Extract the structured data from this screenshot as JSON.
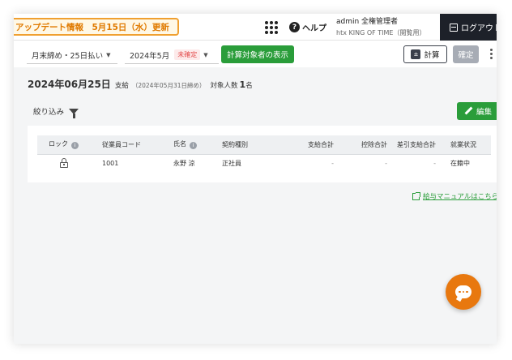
{
  "topbar": {
    "notice": "アップデート情報　5月15日（水）更新",
    "help_label": "ヘルプ",
    "user_name": "admin 全権管理者",
    "tenant_name": "htx KING OF TIME（閲覧用）",
    "logout_label": "ログアウト"
  },
  "toolbar": {
    "closing_select": "月末締め・25日払い",
    "month_select": "2024年5月",
    "unconfirmed_badge": "未確定",
    "target_button": "計算対象者の表示",
    "calc_button": "計算",
    "confirm_button": "確定"
  },
  "summary": {
    "pay_date": "2024年06月25日",
    "pay_type": "支給",
    "closing_note": "（2024年05月31日締め）",
    "count_label": "対象人数",
    "count_value": "1",
    "count_unit": "名"
  },
  "filter": {
    "label": "絞り込み"
  },
  "edit_button": "編集",
  "table": {
    "columns": [
      "ロック",
      "従業員コード",
      "氏名",
      "契約種別",
      "支給合計",
      "控除合計",
      "差引支給合計",
      "就業状況"
    ],
    "rows": [
      {
        "code": "1001",
        "name": "永野 涼",
        "contract": "正社員",
        "pay_total": "-",
        "deduction_total": "-",
        "net_total": "-",
        "status": "在籍中"
      }
    ]
  },
  "manual_link": "給与マニュアルはこちら",
  "colors": {
    "accent_green": "#2a9d3a",
    "notice_orange": "#e07a00",
    "chat_orange": "#e8780f",
    "dark": "#1d2129"
  }
}
